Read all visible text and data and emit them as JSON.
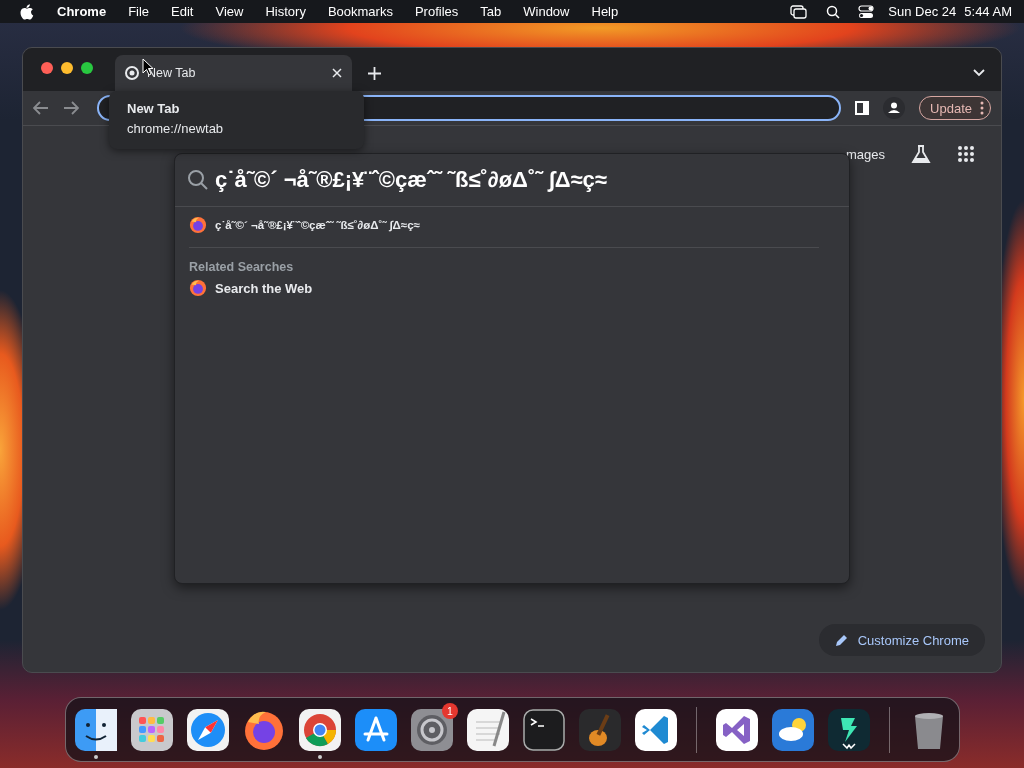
{
  "menu_bar": {
    "app": "Chrome",
    "menus": [
      "File",
      "Edit",
      "View",
      "History",
      "Bookmarks",
      "Profiles",
      "Tab",
      "Window",
      "Help"
    ],
    "date": "Sun Dec 24",
    "time": "5:44 AM"
  },
  "browser": {
    "tabs": [
      {
        "title": "New Tab",
        "selected": true
      }
    ],
    "tooltip": {
      "title": "New Tab",
      "url": "chrome://newtab"
    },
    "update_button": "Update",
    "header_links": [
      "mages"
    ],
    "customize_button": "Customize Chrome"
  },
  "omnibox_popup": {
    "query": "ç˙å˜©´ ¬å˜®£¡¥¨ˆ©çæˆ˜ ˜ß≤˚∂øΔ˚˜ ∫Δ≈ç≈",
    "suggestions": [
      {
        "text": "ç˙å˜©´ ¬å˜®£¡¥¨ˆ©çæˆ˜ ˜ß≤˚∂øΔ˚˜ ∫Δ≈ç≈"
      }
    ],
    "section_title": "Related Searches",
    "related": [
      {
        "text": "Search the Web"
      }
    ]
  },
  "dock": {
    "items": [
      {
        "kind": "finder",
        "running": true
      },
      {
        "kind": "launchpad",
        "running": false
      },
      {
        "kind": "safari",
        "running": false
      },
      {
        "kind": "firefox",
        "running": false
      },
      {
        "kind": "chrome",
        "running": true
      },
      {
        "kind": "appstore",
        "running": false
      },
      {
        "kind": "settings",
        "running": false,
        "badge": "1"
      },
      {
        "kind": "textedit",
        "running": false
      },
      {
        "kind": "terminal",
        "running": false
      },
      {
        "kind": "garageband",
        "running": false
      },
      {
        "kind": "vscode",
        "running": false
      },
      {
        "kind": "separator"
      },
      {
        "kind": "visualstudio",
        "running": false
      },
      {
        "kind": "weather",
        "running": false
      },
      {
        "kind": "filmora",
        "running": false
      },
      {
        "kind": "separator"
      },
      {
        "kind": "trash",
        "running": false
      }
    ]
  }
}
